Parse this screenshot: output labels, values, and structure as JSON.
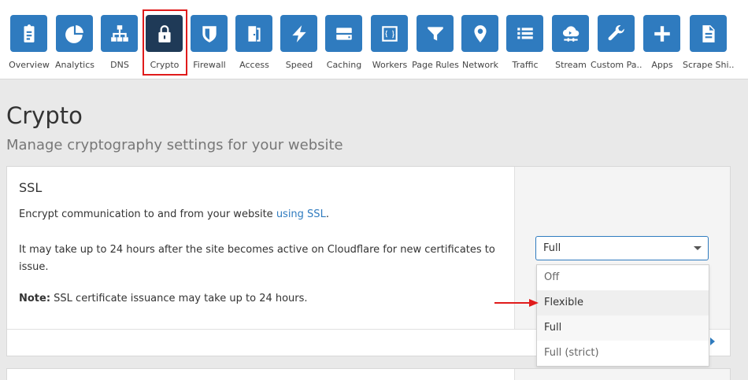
{
  "nav": {
    "items": [
      {
        "label": "Overview",
        "icon": "clipboard-icon"
      },
      {
        "label": "Analytics",
        "icon": "pie-chart-icon"
      },
      {
        "label": "DNS",
        "icon": "network-tree-icon"
      },
      {
        "label": "Crypto",
        "icon": "lock-icon"
      },
      {
        "label": "Firewall",
        "icon": "shield-icon"
      },
      {
        "label": "Access",
        "icon": "door-icon"
      },
      {
        "label": "Speed",
        "icon": "lightning-icon"
      },
      {
        "label": "Caching",
        "icon": "server-drive-icon"
      },
      {
        "label": "Workers",
        "icon": "code-braces-icon"
      },
      {
        "label": "Page Rules",
        "icon": "funnel-icon"
      },
      {
        "label": "Network",
        "icon": "location-pin-icon"
      },
      {
        "label": "Traffic",
        "icon": "list-icon"
      },
      {
        "label": "Stream",
        "icon": "cloud-stream-icon"
      },
      {
        "label": "Custom Pa...",
        "icon": "wrench-icon"
      },
      {
        "label": "Apps",
        "icon": "plus-icon"
      },
      {
        "label": "Scrape Shi...",
        "icon": "document-icon"
      }
    ],
    "active": "Crypto"
  },
  "header": {
    "title": "Crypto",
    "subtitle": "Manage cryptography settings for your website"
  },
  "ssl": {
    "title": "SSL",
    "desc_prefix": "Encrypt communication to and from your website ",
    "desc_link": "using SSL",
    "desc_suffix": ".",
    "note1": "It may take up to 24 hours after the site becomes active on Cloudflare for new certificates to issue.",
    "note2_label": "Note:",
    "note2_text": " SSL certificate issuance may take up to 24 hours.",
    "select_value": "Full",
    "options": [
      "Off",
      "Flexible",
      "Full",
      "Full (strict)"
    ]
  },
  "colors": {
    "nav_tile": "#2f7bbf",
    "nav_tile_active": "#1f3a57",
    "highlight": "#e01b1b",
    "link": "#2f7bbf"
  }
}
